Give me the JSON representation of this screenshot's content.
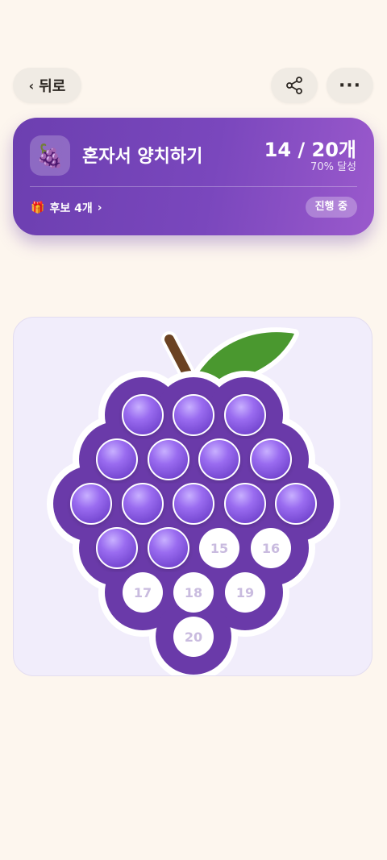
{
  "topbar": {
    "back_label": "뒤로",
    "back_chevron": "‹",
    "share_icon": "share-icon",
    "more_label": "···"
  },
  "card": {
    "emoji": "🍇",
    "title": "혼자서 양치하기",
    "progress": "14 / 20개",
    "rate": "70% 달성",
    "gift_emoji": "🎁",
    "hint": "후보 4개",
    "hint_chevron": "›",
    "status": "진행 중"
  },
  "board": {
    "filled_count": 14,
    "total": 20,
    "empty_labels": [
      "15",
      "16",
      "17",
      "18",
      "19",
      "20"
    ]
  },
  "colors": {
    "background": "#fdf6ee",
    "grape_body": "#6a3aa9",
    "grape_filled": "#9966e8",
    "leaf": "#4a982f",
    "stem": "#6b4222",
    "empty_label": "#c9bbdf"
  }
}
